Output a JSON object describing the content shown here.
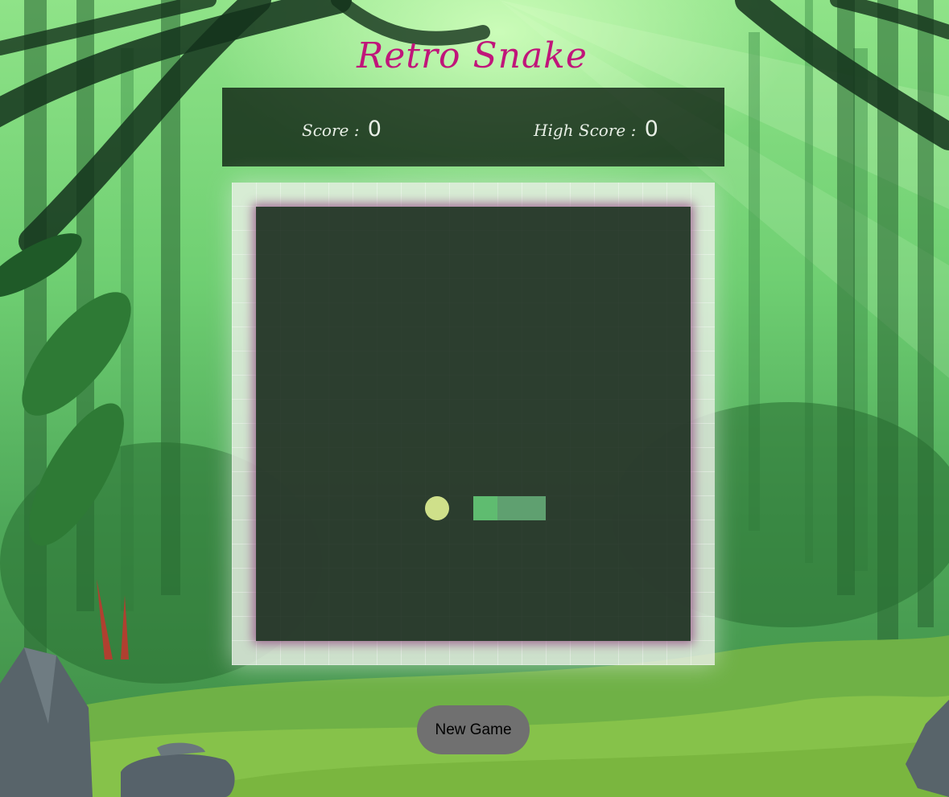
{
  "title": "Retro Snake",
  "scoreboard": {
    "score_label": "Score :",
    "score_value": "0",
    "high_score_label": "High Score :",
    "high_score_value": "0"
  },
  "actions": {
    "new_game_label": "New Game"
  },
  "colors": {
    "title": "#c0157a",
    "snake_head": "#5fbc70",
    "snake_body": "#5fa070",
    "food": "#cfe08a",
    "button": "#707070"
  }
}
